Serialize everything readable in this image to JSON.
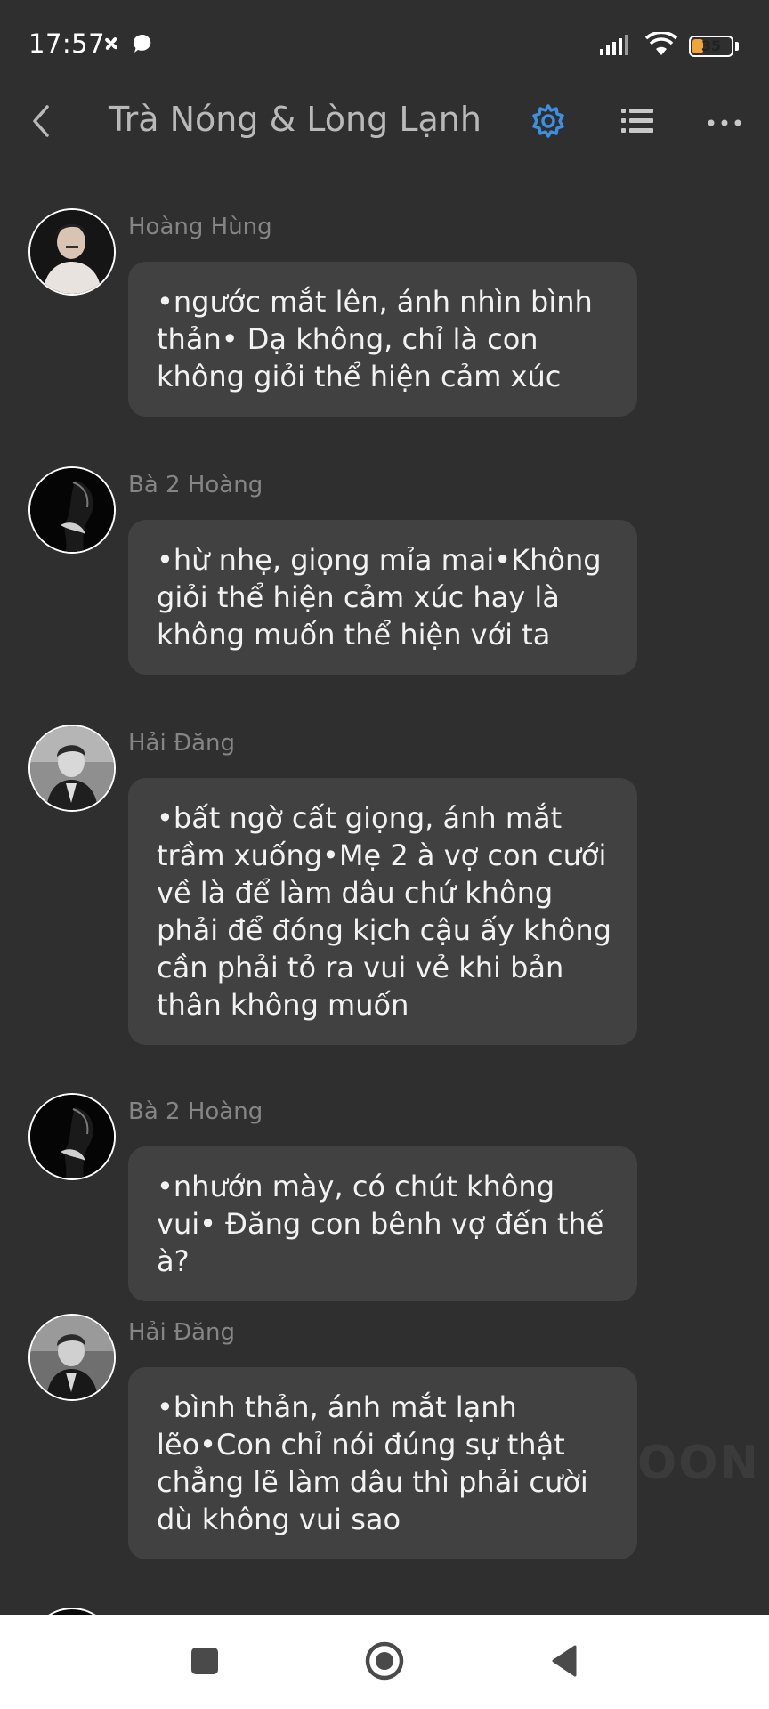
{
  "status_bar": {
    "time": "17:57",
    "battery_level": "35",
    "icons": [
      "pinwheel-icon",
      "chat-bubble-icon",
      "signal-icon",
      "wifi-icon",
      "battery-icon"
    ]
  },
  "app_bar": {
    "title": "Trà Nóng & Lòng Lạnh",
    "icons": [
      "back-icon",
      "settings-icon",
      "list-icon",
      "more-icon"
    ],
    "accent_color": "#3d8fe0"
  },
  "messages": [
    {
      "sender": "Hoàng Hùng",
      "text": "•ngước mắt lên, ánh nhìn bình thản• Dạ không, chỉ là con không giỏi thể hiện cảm xúc"
    },
    {
      "sender": "Bà 2 Hoàng",
      "text": "•hừ nhẹ, giọng mỉa mai•Không giỏi thể hiện cảm xúc hay là không muốn thể hiện với ta"
    },
    {
      "sender": "Hải Đăng",
      "text": "•bất ngờ cất giọng, ánh mắt trầm xuống•Mẹ 2 à vợ con cưới về là để làm dâu chứ không phải để đóng kịch cậu ấy không cần phải tỏ ra vui vẻ khi bản thân không muốn"
    },
    {
      "sender": "Bà 2 Hoàng",
      "text": "•nhướn mày, có chút không vui• Đăng con bênh vợ đến thế à?"
    },
    {
      "sender": "Hải Đăng",
      "text": "•bình thản, ánh mắt lạnh lẽo•Con chỉ nói đúng sự thật chẳng lẽ làm dâu thì phải cười dù không vui sao"
    }
  ],
  "watermark": "OON",
  "nav_bar": {
    "icons": [
      "recents-icon",
      "home-icon",
      "back-triangle-icon"
    ]
  },
  "colors": {
    "background": "#2f2f2f",
    "bubble": "#414141",
    "sender_text": "#858585",
    "message_text": "#f2f2f2",
    "title_text": "#b9b9b9"
  }
}
